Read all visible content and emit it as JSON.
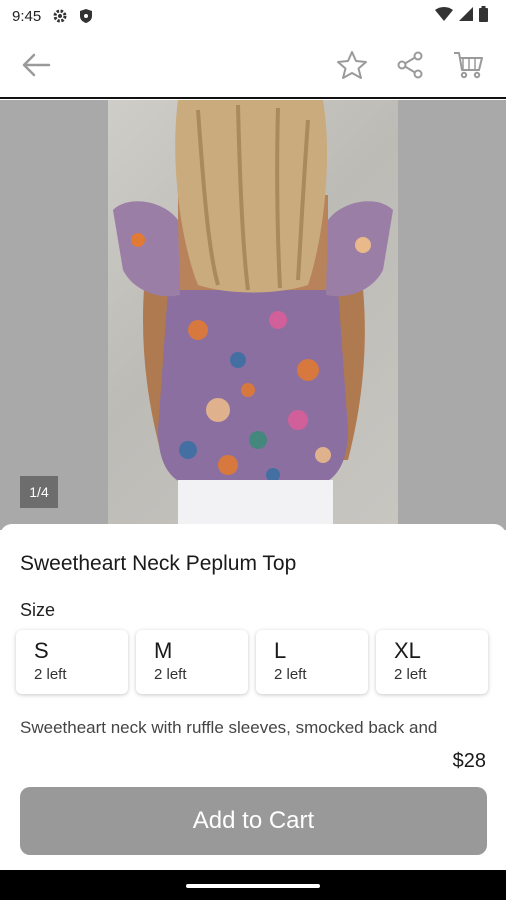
{
  "status_bar": {
    "time": "9:45",
    "icons": [
      "settings-icon",
      "shield-icon",
      "wifi-icon",
      "signal-icon",
      "battery-icon"
    ]
  },
  "app_bar": {
    "icons": [
      "back-arrow-icon",
      "star-icon",
      "share-icon",
      "cart-icon"
    ]
  },
  "gallery": {
    "counter": "1/4"
  },
  "product": {
    "title": "Sweetheart Neck Peplum Top",
    "size_label": "Size",
    "sizes": [
      {
        "name": "S",
        "stock": "2 left"
      },
      {
        "name": "M",
        "stock": "2 left"
      },
      {
        "name": "L",
        "stock": "2 left"
      },
      {
        "name": "XL",
        "stock": "2 left"
      }
    ],
    "description": "Sweetheart neck with ruffle sleeves, smocked back and",
    "price": "$28",
    "add_to_cart_label": "Add to Cart"
  },
  "colors": {
    "button": "#999999",
    "image_bg": "#a9a9a9"
  }
}
